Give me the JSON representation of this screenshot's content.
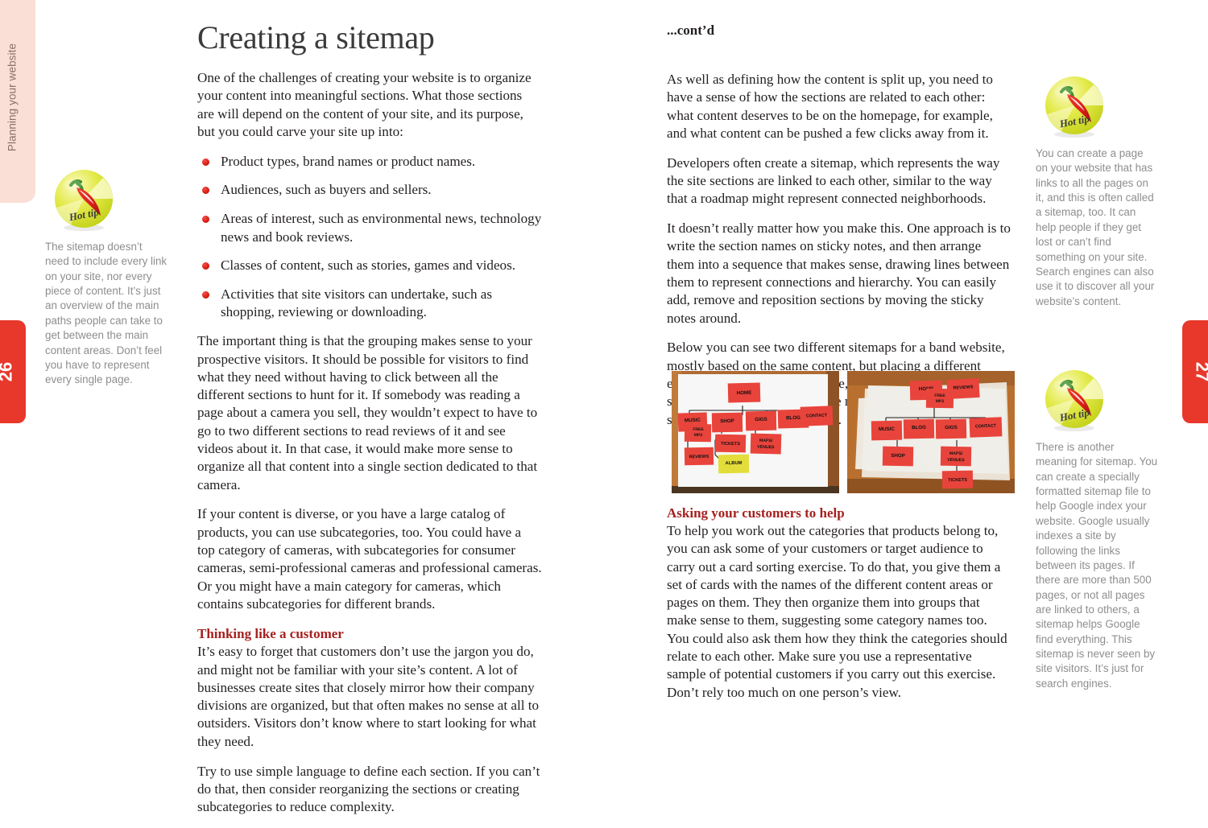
{
  "book": {
    "chapter_tab_label": "Planning your website",
    "page_left": "26",
    "page_right": "27",
    "accent_red": "#a5211f",
    "tab_red": "#e8372b",
    "tab_pink": "#fadfd6",
    "sidebar_gray": "#8e8e90"
  },
  "left_page": {
    "title": "Creating a sitemap",
    "intro": "One of the challenges of creating your website is to organize your content into meaningful sections. What those sections are will depend on the content of your site, and its purpose, but you could carve your site up into:",
    "bullets": [
      "Product types, brand names or product names.",
      "Audiences, such as buyers and sellers.",
      "Areas of interest, such as environmental news, technology news and book reviews.",
      "Classes of content, such as stories, games and videos.",
      "Activities that site visitors can undertake, such as shopping, reviewing or downloading."
    ],
    "para_grouping": "The important thing is that the grouping makes sense to your prospective visitors. It should be possible for visitors to find what they need without having to click between all the different sections to hunt for it. If somebody was reading a page about a camera you sell, they wouldn’t expect to have to go to two different sections to read reviews of it and see videos about it. In that case, it would make more sense to organize all that content into a single section dedicated to that camera.",
    "para_subcategories": "If your content is diverse, or you have a large catalog of products, you can use subcategories, too. You could have a top category of cameras, with subcategories for consumer cameras, semi-professional cameras and professional cameras. Or you might have a main category for cameras, which contains subcategories for different brands.",
    "subhead_customer": "Thinking like a customer",
    "para_jargon": "It’s easy to forget that customers don’t use the jargon you do, and might not be familiar with your site’s content. A lot of businesses create sites that closely mirror how their company divisions are organized, but that often makes no sense at all to outsiders. Visitors don’t know where to start looking for what they need.",
    "para_simple_language": "Try to use simple language to define each section. If you can’t do that, then consider reorganizing the sections or creating subcategories to reduce complexity."
  },
  "right_page": {
    "title": "...cont’d",
    "para_relations": "As well as defining how the content is split up, you need to have a sense of how the sections are related to each other: what content deserves to be on the homepage, for example, and what content can be pushed a few clicks away from it.",
    "para_developers": "Developers often create a sitemap, which represents the way the site sections are linked to each other, similar to the way that a roadmap might represent connected neighborhoods.",
    "para_sticky_notes": "It doesn’t really matter how you make this. One approach is to write the section names on sticky notes, and then arrange them into a sequence that makes sense, drawing lines between them to represent connections and hierarchy. You can easily add, remove and reposition sections by moving the sticky notes around.",
    "para_below": "Below you can see two different sitemaps for a band website, mostly based on the same content, but placing a different emphasis. The first, for example, has the shop as a major section. The second pushes free music to the homepage and sells through the Music section.",
    "subhead_customers_help": "Asking your customers to help",
    "para_card_sorting": "To help you work out the categories that products belong to, you can ask some of your customers or target audience to carry out a card sorting exercise. To do that, you give them a set of cards with the names of the different content areas or pages on them. They then organize them into groups that make sense to them, suggesting some category names too. You could also ask them how they think the categories should relate to each other. Make sure you use a representative sample of potential customers if you carry out this exercise. Don’t rely too much on one person’s view."
  },
  "side_notes": {
    "left_1": {
      "badge_label": "Hot tip",
      "text": "The sitemap doesn’t need to include every link on your site, nor every piece of content. It’s just an overview of the main paths people can take to get between the main content areas. Don’t feel you have to represent every single page."
    },
    "right_1": {
      "badge_label": "Hot tip",
      "text": "You can create a page on your website that has links to all the pages on it, and this is often called a sitemap, too. It can help people if they get lost or can’t find something on your site. Search engines can also use it to discover all your website’s content."
    },
    "right_2": {
      "badge_label": "Hot tip",
      "text": "There is another meaning for sitemap. You can create a specially formatted sitemap file to help Google index your website. Google usually indexes a site by following the links between its pages. If there are more than 500 pages, or not all pages are linked to others, a sitemap helps Google find everything. This sitemap is never seen by site visitors. It’s just for search engines."
    }
  },
  "photos": [
    {
      "caption_alt": "Sitemap on whiteboard with shop as a major section",
      "notes": [
        "HOME",
        "MUSIC",
        "FREE MP3",
        "REVIEWS",
        "SHOP",
        "TICKETS",
        "ALBUM",
        "GIGS",
        "MAPS/ VENUES",
        "BLOG",
        "CONTACT"
      ]
    },
    {
      "caption_alt": "Sitemap on paper with free music on the homepage",
      "notes": [
        "HOME",
        "FREE MP3",
        "REVIEWS",
        "MUSIC",
        "SHOP",
        "BLOG",
        "GIGS",
        "MAPS/ VENUES",
        "TICKETS",
        "CONTACT"
      ]
    }
  ]
}
